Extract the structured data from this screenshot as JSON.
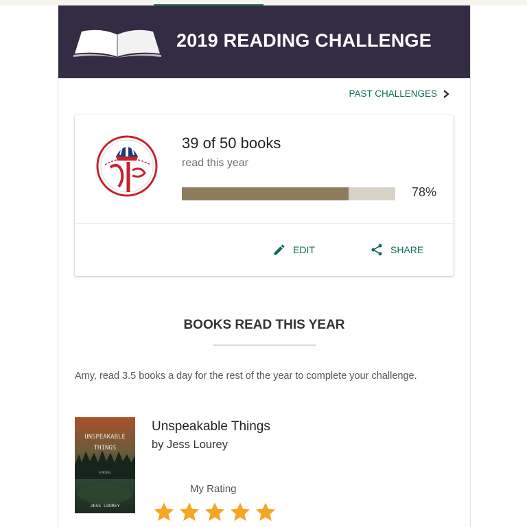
{
  "header": {
    "banner_title": "2019 READING CHALLENGE",
    "book_icon": "open-book-icon",
    "banner_color": "#342c44"
  },
  "past_challenges": {
    "label": "PAST CHALLENGES",
    "icon": "chevron-right-icon"
  },
  "challenge_card": {
    "logo": "yankees-logo",
    "count_text": "39 of 50 books",
    "subtitle": "read this year",
    "progress_fraction": 0.78,
    "progress_label": "78%",
    "edit_label": "EDIT",
    "edit_icon": "pencil-icon",
    "share_label": "SHARE",
    "share_icon": "share-icon",
    "accent_color": "#0f6a5a",
    "progress_color": "#8e7c5d"
  },
  "books_section": {
    "title": "BOOKS READ THIS YEAR",
    "message": "Amy, read 3.5 books a day for the rest of the year to complete your challenge.",
    "books": [
      {
        "title": "Unspeakable Things",
        "author": "by Jess Lourey",
        "cover_title_line1": "UNSPEAKABLE",
        "cover_title_line2": "THINGS",
        "cover_subtitle": "A NOVEL",
        "cover_author": "JESS LOUREY",
        "rating_label": "My Rating",
        "rating": 5,
        "star_color": "#f5a623"
      }
    ]
  }
}
